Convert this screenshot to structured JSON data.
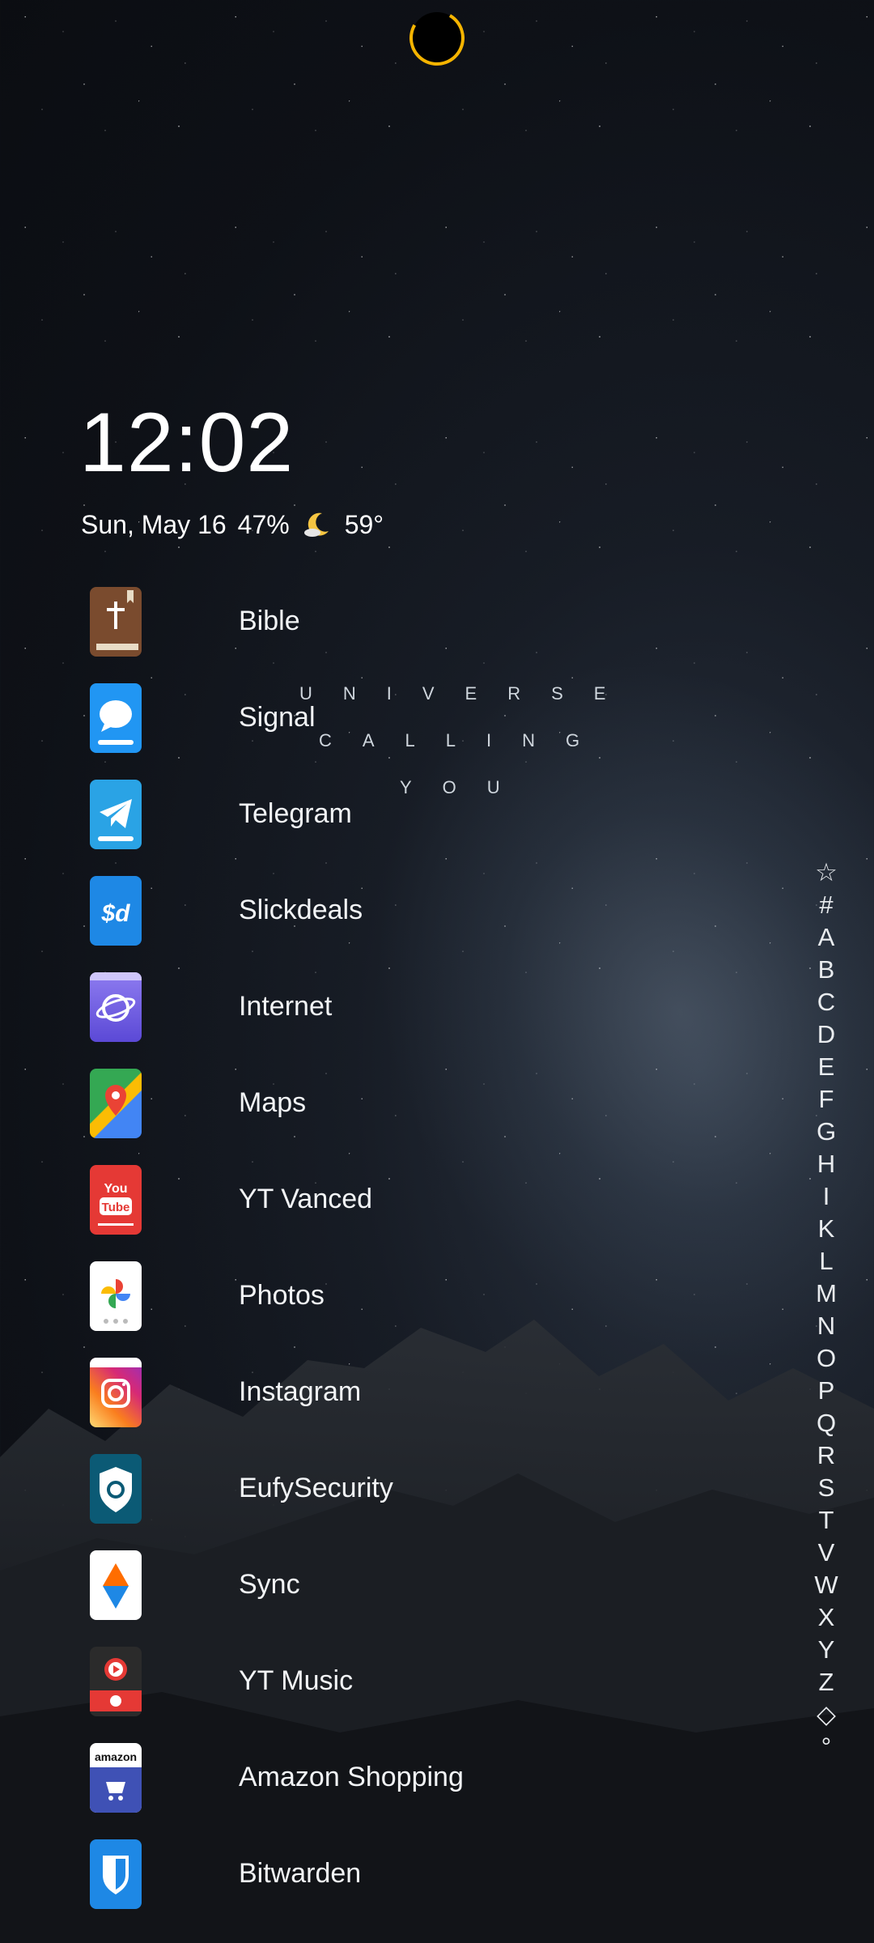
{
  "clock": {
    "time": "12:02"
  },
  "status": {
    "date": "Sun, May 16",
    "battery": "47%",
    "temperature": "59°",
    "weather_icon": "moon-icon"
  },
  "wallpaper_text": {
    "line1": "UNIVERSE",
    "line2": "CALLING",
    "line3": "YOU"
  },
  "apps": [
    {
      "label": "Bible",
      "icon": "bible-icon",
      "color": "#7a4b2e"
    },
    {
      "label": "Signal",
      "icon": "signal-icon",
      "color": "#2196f3"
    },
    {
      "label": "Telegram",
      "icon": "telegram-icon",
      "color": "#2aa3e5"
    },
    {
      "label": "Slickdeals",
      "icon": "slickdeals-icon",
      "color": "#1e88e5"
    },
    {
      "label": "Internet",
      "icon": "internet-icon",
      "color": "#6c5ce7"
    },
    {
      "label": "Maps",
      "icon": "maps-icon",
      "color": "#34a853"
    },
    {
      "label": "YT Vanced",
      "icon": "youtube-icon",
      "color": "#e53935"
    },
    {
      "label": "Photos",
      "icon": "photos-icon",
      "color": "#ffffff"
    },
    {
      "label": "Instagram",
      "icon": "instagram-icon",
      "color": "#e1306c"
    },
    {
      "label": "EufySecurity",
      "icon": "eufy-icon",
      "color": "#0b5a75"
    },
    {
      "label": "Sync",
      "icon": "sync-icon",
      "color": "#ffffff"
    },
    {
      "label": "YT Music",
      "icon": "yt-music-icon",
      "color": "#e53935"
    },
    {
      "label": "Amazon Shopping",
      "icon": "amazon-icon",
      "color": "#3f51b5"
    },
    {
      "label": "Bitwarden",
      "icon": "bitwarden-icon",
      "color": "#1e88e5"
    }
  ],
  "az_index": [
    "☆",
    "#",
    "A",
    "B",
    "C",
    "D",
    "E",
    "F",
    "G",
    "H",
    "I",
    "K",
    "L",
    "M",
    "N",
    "O",
    "P",
    "Q",
    "R",
    "S",
    "T",
    "V",
    "W",
    "X",
    "Y",
    "Z",
    "◇",
    "°"
  ]
}
